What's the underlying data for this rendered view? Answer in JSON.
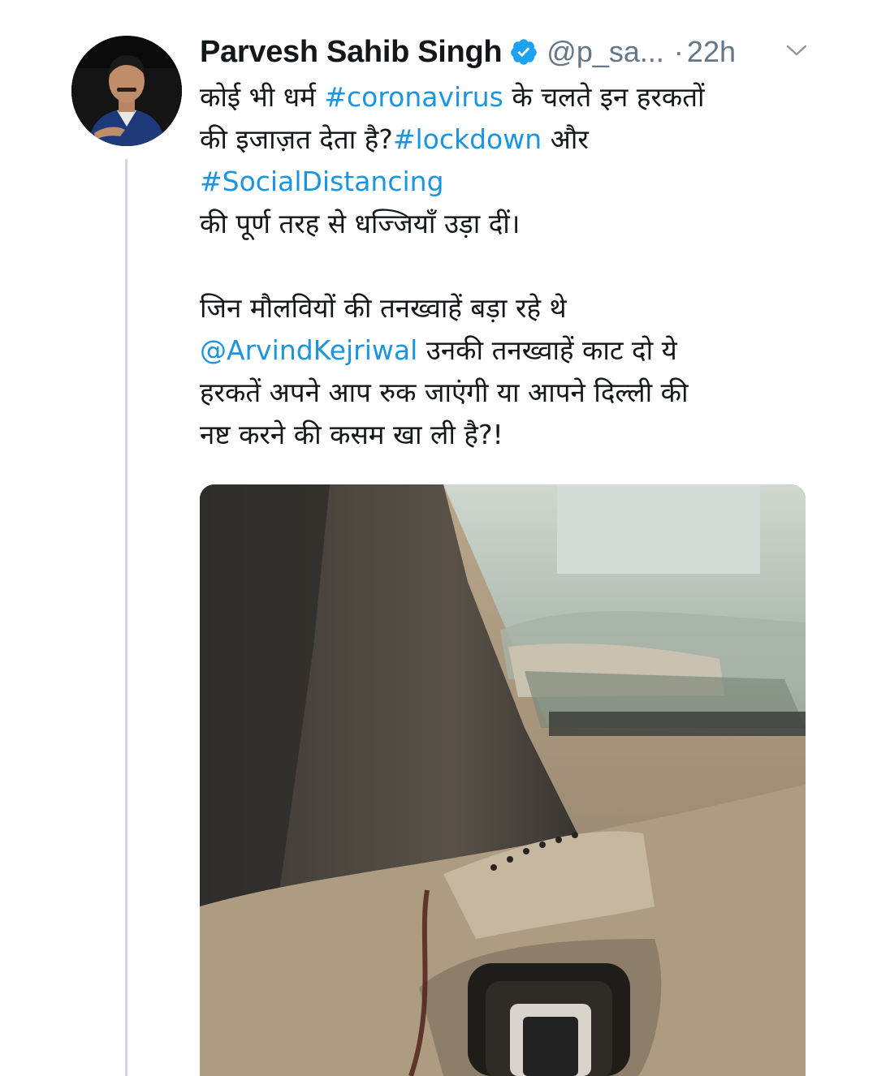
{
  "tweet": {
    "author_name": "Parvesh Sahib Singh",
    "handle": "@p_sa...",
    "separator": "·",
    "time": "22h",
    "verified_icon": "verified-badge-icon",
    "menu_icon": "chevron-down-icon",
    "text": {
      "l1_a": "कोई भी धर्म ",
      "l1_tag": "#coronavirus",
      "l1_b": " के चलते इन हरकतों",
      "l2_a": "की इजाज़त देता है?",
      "l2_tag": "#lockdown",
      "l2_b": " और",
      "l3_tag": "#SocialDistancing",
      "l4": "की पूर्ण तरह से धज्जियाँ उड़ा दीं।",
      "l5": "जिन मौलवियों की तनख्वाहें बड़ा रहे थे",
      "l6_mention": "@ArvindKejriwal",
      "l6_b": " उनकी तनख्वाहें काट दो ये",
      "l7": "हरकतें अपने आप रुक जाएंगी या आपने दिल्ली की",
      "l8": "नष्ट करने की कसम खा ली है?!"
    }
  },
  "colors": {
    "link": "#1b95e0",
    "muted": "#657786",
    "verified": "#1da1f2",
    "thread_line": "#cfd6dc"
  }
}
